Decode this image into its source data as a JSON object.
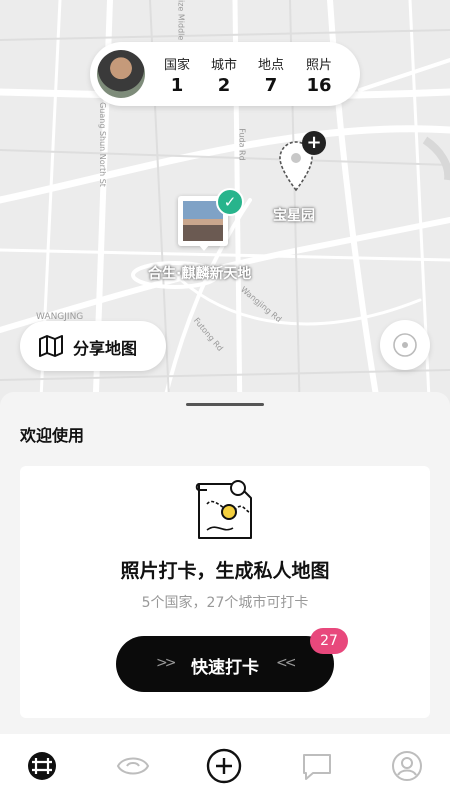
{
  "map": {
    "road_labels": [
      "Lize Middle Rd",
      "Fuda Rd",
      "Wangjing Rd",
      "Guang Shun North St",
      "Futong Rd",
      "WANGJING"
    ],
    "places": [
      {
        "name": "合生·麒麟新天地",
        "type": "photo-pin",
        "checked": true
      },
      {
        "name": "宝星园",
        "type": "location-pin"
      }
    ]
  },
  "stats": {
    "items": [
      {
        "label": "国家",
        "value": "1"
      },
      {
        "label": "城市",
        "value": "2"
      },
      {
        "label": "地点",
        "value": "7"
      },
      {
        "label": "照片",
        "value": "16"
      }
    ]
  },
  "share_label": "分享地图",
  "sheet": {
    "title": "欢迎使用",
    "card": {
      "illustration": "map-illustration-icon",
      "headline": "照片打卡，生成私人地图",
      "subtitle": "5个国家，27个城市可打卡",
      "cta_label": "快速打卡",
      "badge_count": "27"
    }
  },
  "tabs": [
    {
      "icon": "globe-icon",
      "active": true
    },
    {
      "icon": "eye-icon",
      "active": false
    },
    {
      "icon": "plus-circle-icon",
      "active": false
    },
    {
      "icon": "chat-icon",
      "active": false
    },
    {
      "icon": "profile-icon",
      "active": false
    }
  ],
  "colors": {
    "accent_green": "#28b48c",
    "badge_pink": "#e8487c",
    "cta_black": "#0b0b0b"
  }
}
